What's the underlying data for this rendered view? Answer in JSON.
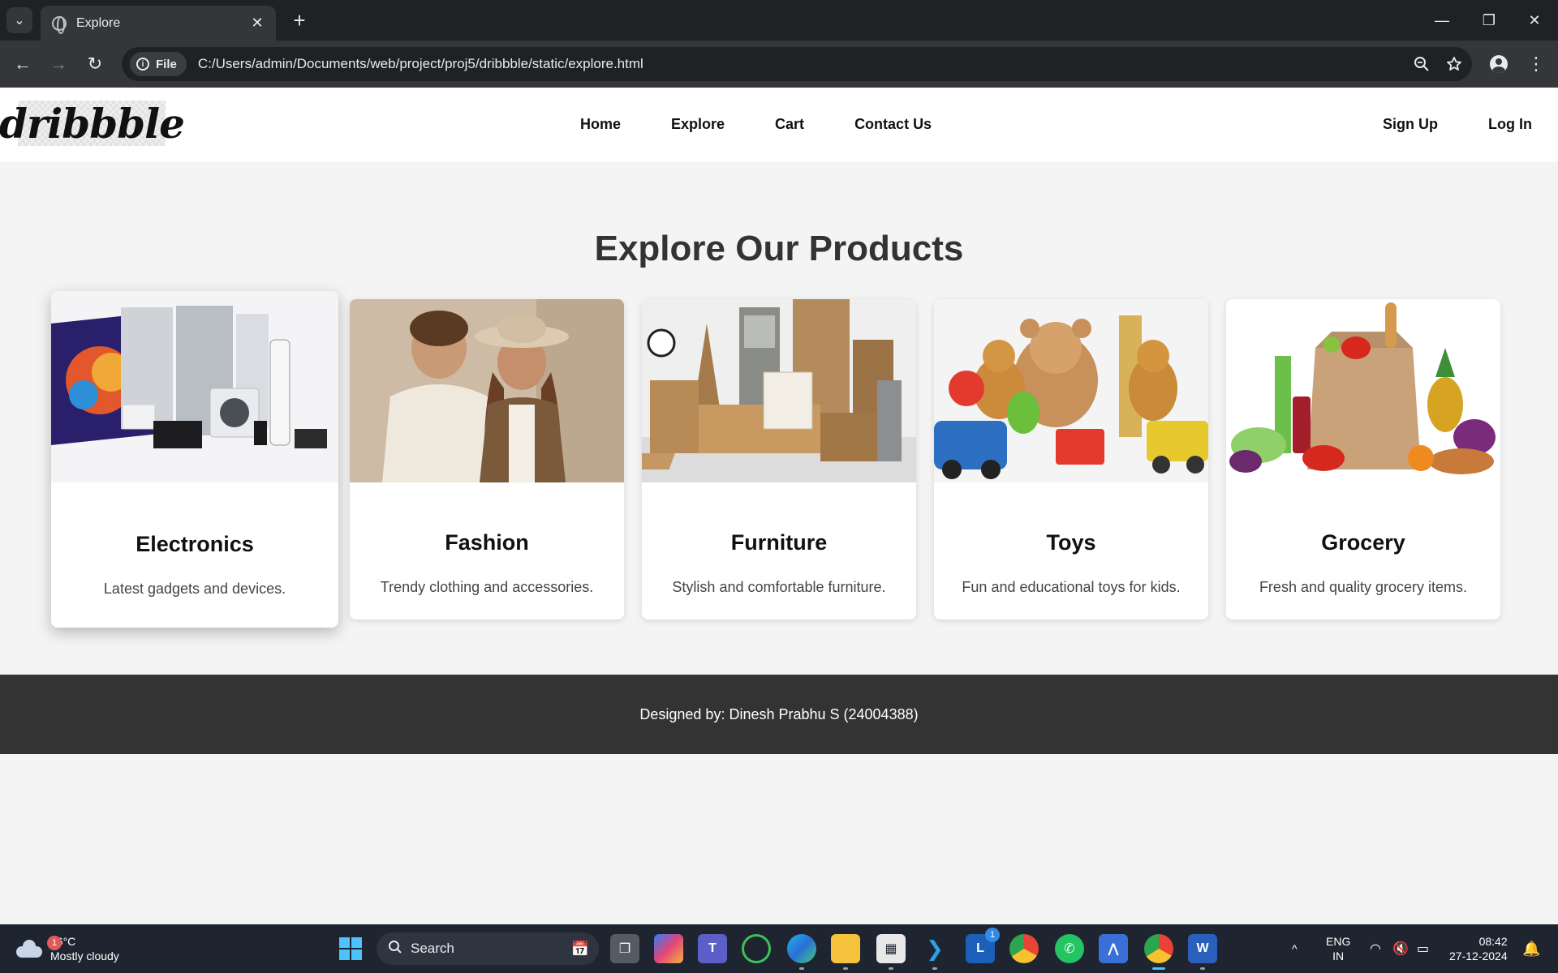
{
  "browser": {
    "tab_title": "Explore",
    "tab_close": "✕",
    "new_tab": "+",
    "tab_list": "⌄",
    "window_controls": {
      "minimize": "—",
      "restore": "❐",
      "close": "✕"
    },
    "nav": {
      "back": "←",
      "forward": "→",
      "reload": "↻"
    },
    "address_chip": "File",
    "url": "C:/Users/admin/Documents/web/project/proj5/dribbble/static/explore.html",
    "icons": {
      "zoom": "zoom-icon",
      "bookmark": "star-icon",
      "profile": "profile-icon",
      "menu": "kebab-menu-icon"
    }
  },
  "site": {
    "logo_text": "dribbble",
    "nav": [
      "Home",
      "Explore",
      "Cart",
      "Contact Us"
    ],
    "auth": [
      "Sign Up",
      "Log In"
    ],
    "heading": "Explore Our Products",
    "categories": [
      {
        "name": "Electronics",
        "description": "Latest gadgets and devices."
      },
      {
        "name": "Fashion",
        "description": "Trendy clothing and accessories."
      },
      {
        "name": "Furniture",
        "description": "Stylish and comfortable furniture."
      },
      {
        "name": "Toys",
        "description": "Fun and educational toys for kids."
      },
      {
        "name": "Grocery",
        "description": "Fresh and quality grocery items."
      }
    ],
    "footer": "Designed by: Dinesh Prabhu S (24004388)"
  },
  "taskbar": {
    "weather": {
      "badge": "1",
      "temp": "26°C",
      "condition": "Mostly cloudy"
    },
    "search_placeholder": "Search",
    "apps": [
      "task-view",
      "copilot",
      "teams",
      "app-green",
      "edge",
      "file-explorer",
      "store",
      "vscode",
      "app-l",
      "chrome-alt",
      "whatsapp",
      "app-a",
      "chrome",
      "word"
    ],
    "app_l_badge": "1",
    "tray_chevron": "^",
    "lang": {
      "line1": "ENG",
      "line2": "IN"
    },
    "time": "08:42",
    "date": "27-12-2024"
  },
  "colors": {
    "page_bg": "#f4f4f4",
    "footer_bg": "#333333",
    "chrome_dark": "#202124",
    "chrome_toolbar": "#35363a",
    "taskbar": "#1f2530"
  }
}
